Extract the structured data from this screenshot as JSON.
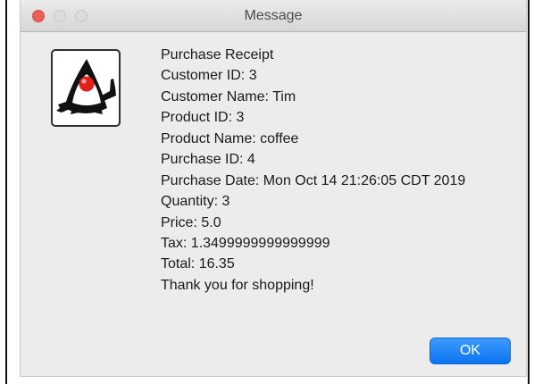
{
  "window": {
    "title": "Message"
  },
  "message": {
    "lines": [
      "Purchase Receipt",
      "Customer ID: 3",
      "Customer Name: Tim",
      "Product ID: 3",
      "Product Name: coffee",
      "Purchase ID: 4",
      "Purchase Date: Mon Oct 14 21:26:05 CDT 2019",
      "Quantity: 3",
      "Price: 5.0",
      "Tax: 1.3499999999999999",
      "Total: 16.35",
      "Thank you for shopping!"
    ]
  },
  "buttons": {
    "ok_label": "OK"
  },
  "icons": {
    "dialog_icon": "java-duke-icon"
  },
  "colors": {
    "close_button": "#ed5e58",
    "ok_button": "#0a74f0",
    "dialog_background": "#ececec"
  }
}
